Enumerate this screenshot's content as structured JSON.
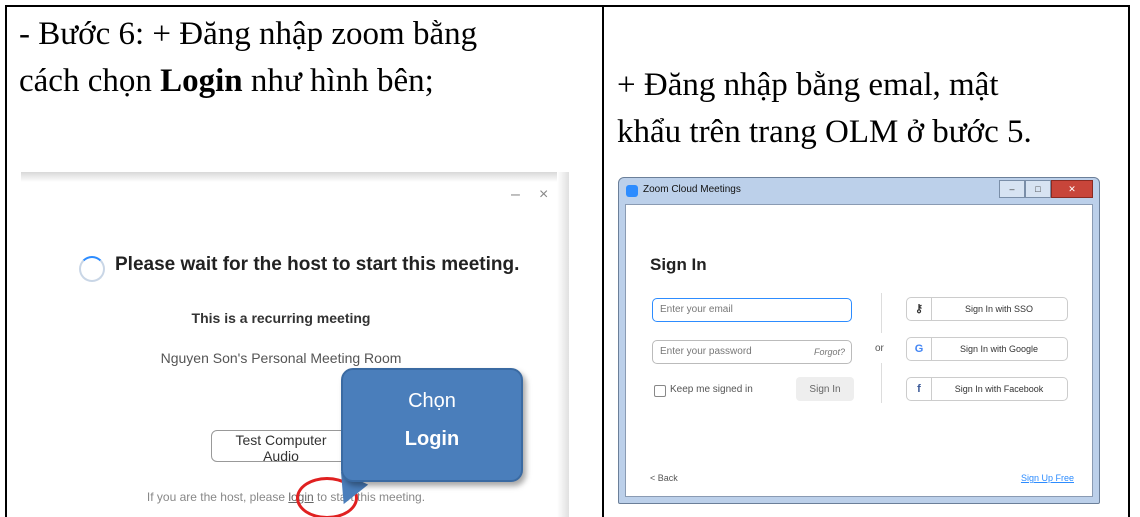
{
  "left_cell": {
    "line1": "- Bước 6: + Đăng nhập zoom bằng",
    "line2_prefix": "cách chọn ",
    "line2_bold": "Login",
    "line2_suffix": " như hình bên;"
  },
  "right_cell": {
    "line1": "+ Đăng nhập bằng emal, mật",
    "line2": "khẩu trên trang OLM ở bước 5."
  },
  "wait_dialog": {
    "minimize_glyph": "–",
    "close_glyph": "×",
    "title": "Please wait for the host to start this meeting.",
    "subtitle": "This is a recurring meeting",
    "room": "Nguyen Son's Personal Meeting Room",
    "test_button": "Test Computer Audio",
    "footer_prefix": "If you are the host, please ",
    "footer_link": "login",
    "footer_suffix": " to start this meeting."
  },
  "callout": {
    "line1": "Chọn",
    "line2": "Login"
  },
  "zoom_window": {
    "title": "Zoom Cloud Meetings",
    "heading": "Sign In",
    "email_placeholder": "Enter your email",
    "password_placeholder": "Enter your password",
    "forgot": "Forgot?",
    "keep_signed_in": "Keep me signed in",
    "signin_button": "Sign In",
    "or": "or",
    "sso_label": "Sign In with SSO",
    "google_label": "Sign In with Google",
    "facebook_label": "Sign In with Facebook",
    "back": "< Back",
    "signup": "Sign Up Free"
  },
  "colors": {
    "zoom_blue": "#2d8cff",
    "callout_fill": "#4a7ebb",
    "highlight_red": "#e02020"
  },
  "icons": {
    "sso": "key-icon",
    "google": "google-g-icon",
    "facebook": "facebook-f-icon"
  }
}
